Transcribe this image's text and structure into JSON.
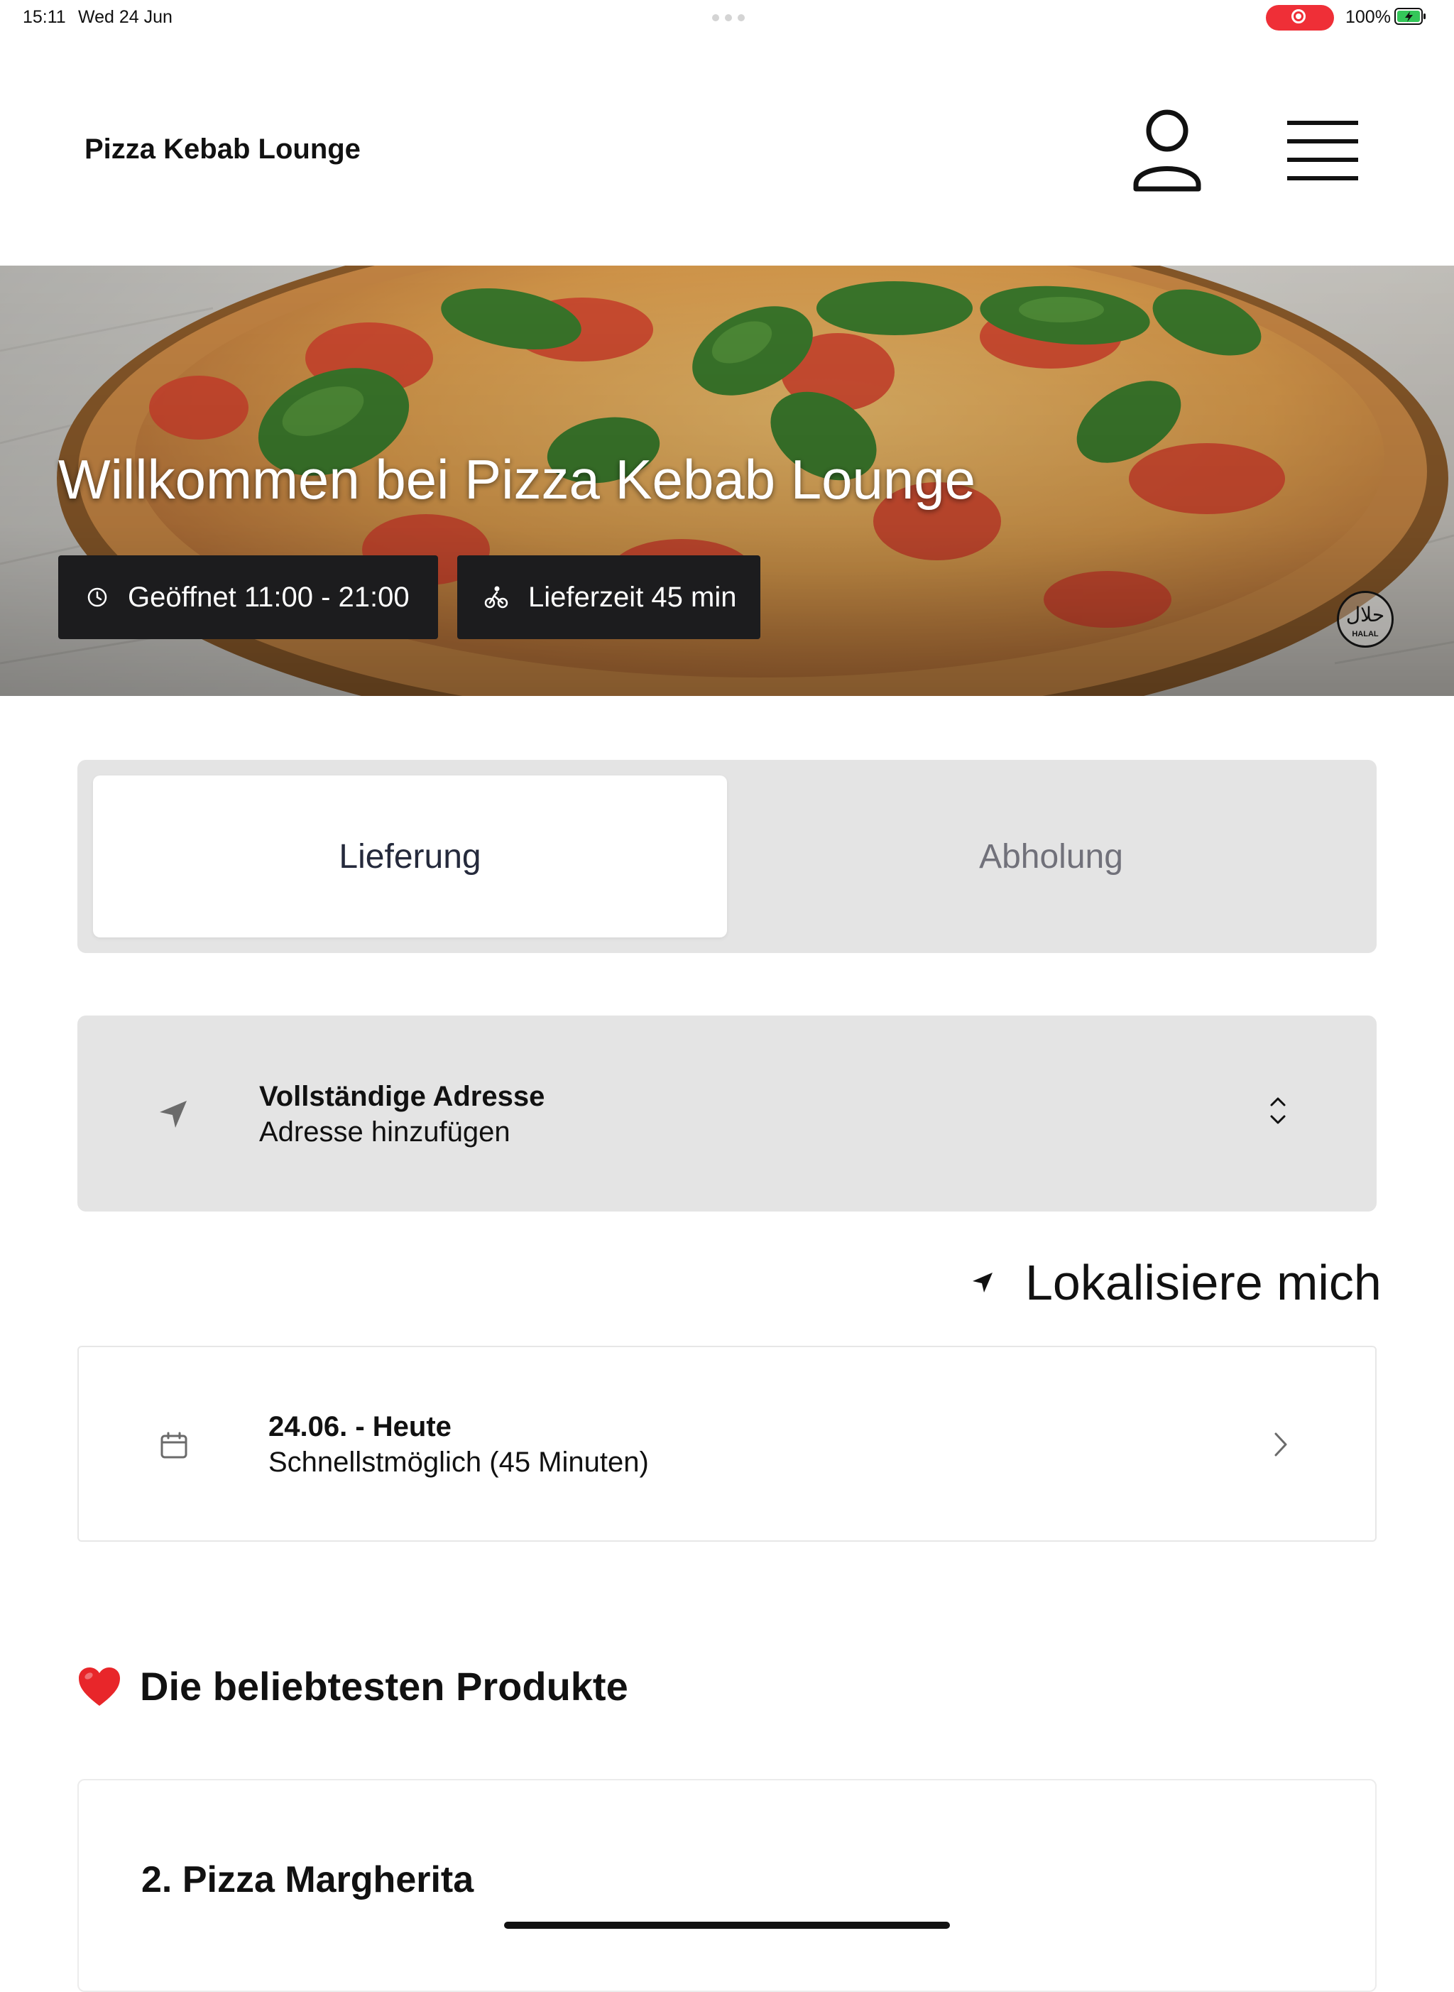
{
  "status_bar": {
    "time": "15:11",
    "date": "Wed 24 Jun",
    "battery": "100%",
    "recording_color": "#ef2f37",
    "battery_color": "#34c759"
  },
  "header": {
    "brand": "Pizza Kebab Lounge",
    "icons": {
      "account": "user-icon",
      "menu": "hamburger-menu-icon"
    }
  },
  "hero": {
    "title": "Willkommen bei Pizza Kebab Lounge",
    "badge": "halal-icon",
    "opening_hours": "Geöffnet 11:00 - 21:00",
    "delivery_time": "Lieferzeit 45 min"
  },
  "order_type": {
    "options": [
      "Lieferung",
      "Abholung"
    ],
    "selected": "Lieferung"
  },
  "address": {
    "label": "Vollständige Adresse",
    "value": "Adresse hinzufügen"
  },
  "locate": {
    "label": "Lokalisiere mich"
  },
  "schedule": {
    "date": "24.06. - Heute",
    "time": "Schnellstmöglich (45 Minuten)"
  },
  "popular": {
    "title": "Die beliebtesten Produkte",
    "heart_color": "#e8262a",
    "products": [
      {
        "name": "2. Pizza Margherita"
      }
    ]
  }
}
